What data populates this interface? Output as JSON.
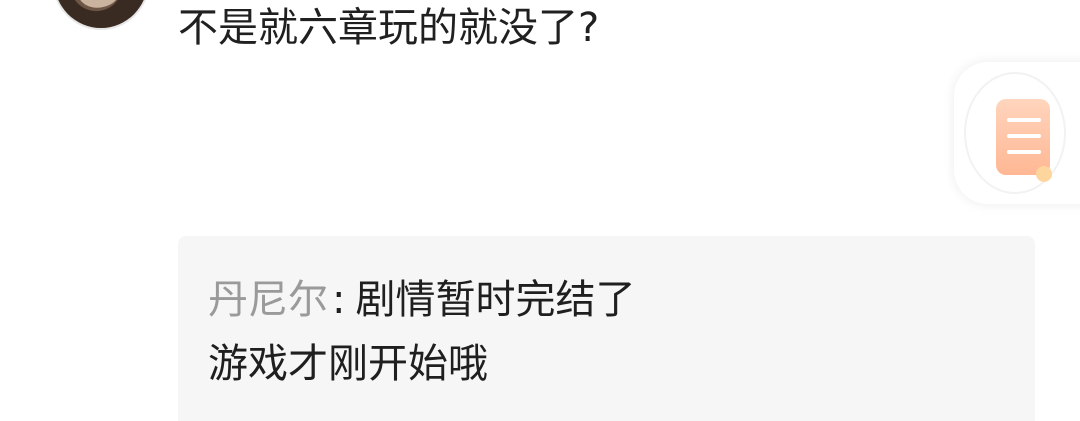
{
  "comment": {
    "text": "不是就六章玩的就没了?"
  },
  "reply": {
    "author": "丹尼尔",
    "separator": ":",
    "line1": "剧情暂时完结了",
    "line2": "游戏才刚开始哦"
  },
  "floating_button": {
    "icon": "chat-icon"
  },
  "colors": {
    "background": "#ffffff",
    "reply_background": "#f6f6f6",
    "author_gray": "#9a9a9a",
    "accent_orange": "#ffb794"
  }
}
